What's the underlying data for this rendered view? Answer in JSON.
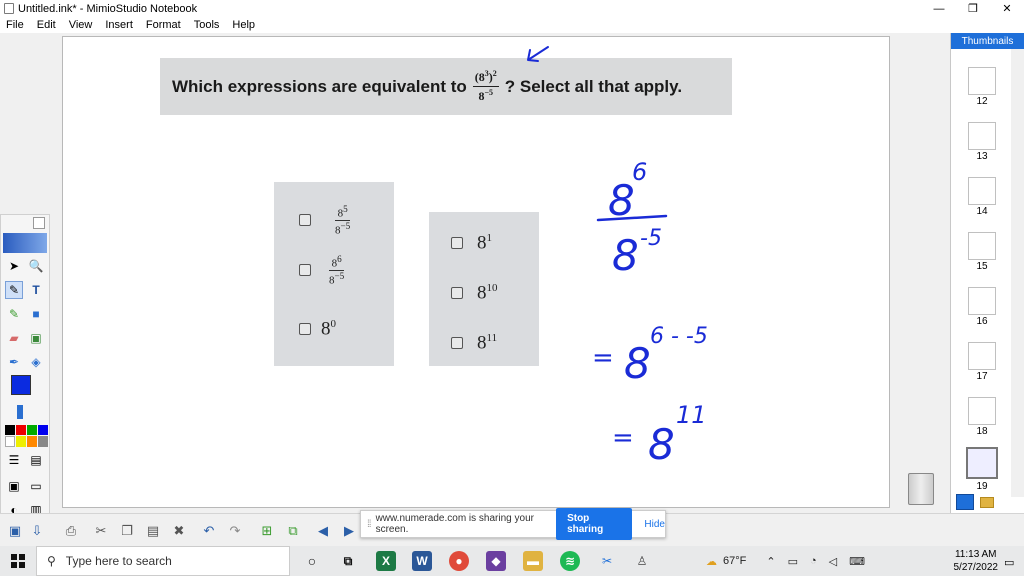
{
  "window": {
    "title": "Untitled.ink* - MimioStudio Notebook",
    "controls": [
      "—",
      "❐",
      "✕"
    ]
  },
  "menu": [
    "File",
    "Edit",
    "View",
    "Insert",
    "Format",
    "Tools",
    "Help"
  ],
  "question": {
    "prefix": "Which expressions are equivalent to",
    "numerator_base": "(8",
    "numerator_inner_exp": "3",
    "numerator_close": ")",
    "numerator_outer_exp": "2",
    "denominator_base": "8",
    "denominator_exp": "−5",
    "suffix": "? Select all that apply."
  },
  "choices_left": [
    {
      "num_base": "8",
      "num_exp": "5",
      "den_base": "8",
      "den_exp": "−5"
    },
    {
      "num_base": "8",
      "num_exp": "6",
      "den_base": "8",
      "den_exp": "−5"
    },
    {
      "base": "8",
      "exp": "0"
    }
  ],
  "choices_right": [
    {
      "base": "8",
      "exp": "1"
    },
    {
      "base": "8",
      "exp": "10"
    },
    {
      "base": "8",
      "exp": "11"
    }
  ],
  "handwriting": {
    "fraction_numerator": "8",
    "fraction_num_exp": "6",
    "fraction_denominator": "8",
    "fraction_den_exp": "-5",
    "line2_eq": "=",
    "line2_base": "8",
    "line2_exp": "6 - -5",
    "line3_eq": "=",
    "line3_base": "8",
    "line3_exp": "11",
    "ink_color": "#1a2bd6"
  },
  "thumbnails": {
    "header": "Thumbnails",
    "pages": [
      "12",
      "13",
      "14",
      "15",
      "16",
      "17",
      "18",
      "19"
    ],
    "active": "19"
  },
  "sharing": {
    "message": "www.numerade.com is sharing your screen.",
    "stop_label": "Stop sharing",
    "hide_label": "Hide"
  },
  "taskbar": {
    "search_placeholder": "Type here to search",
    "weather": "67°F",
    "time": "11:13 AM",
    "date": "5/27/2022"
  },
  "colors": {
    "accent": "#1e6fd9",
    "active_tool_color": "#0b2be0"
  }
}
